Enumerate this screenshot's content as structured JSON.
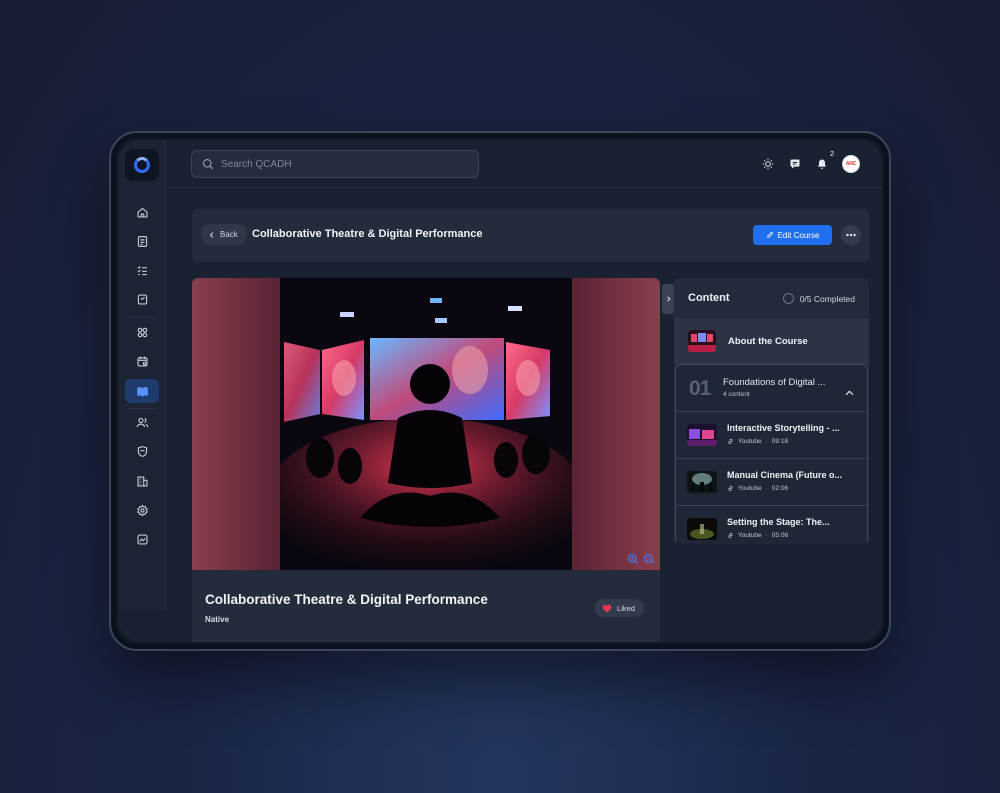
{
  "search": {
    "placeholder": "Search QCADH"
  },
  "topbar": {
    "notification_count": "2",
    "avatar_text": "ANC"
  },
  "header": {
    "back_label": "Back",
    "title": "Collaborative Theatre & Digital Performance",
    "edit_label": "Edit Course"
  },
  "course": {
    "title": "Collaborative Theatre & Digital Performance",
    "subtitle": "Native",
    "liked_label": "Liked"
  },
  "content": {
    "title": "Content",
    "completed": "0/5 Completed",
    "about_label": "About the Course",
    "section": {
      "number": "01",
      "title": "Foundations of Digital ...",
      "count": "4 content"
    },
    "lessons": [
      {
        "title": "Interactive Storytelling - ...",
        "source": "Youtube",
        "duration": "09:18"
      },
      {
        "title": "Manual Cinema (Future o...",
        "source": "Youtube",
        "duration": "02:06"
      },
      {
        "title": "Setting the Stage: The...",
        "source": "Youtube",
        "duration": "05:06"
      }
    ]
  },
  "sidebar": {
    "icons": [
      "home-icon",
      "document-icon",
      "checklist-icon",
      "bookmark-icon",
      "grid-icon",
      "calendar-icon",
      "book-icon",
      "users-icon",
      "shield-icon",
      "building-icon",
      "settings-icon",
      "chart-icon"
    ],
    "active": "book-icon"
  },
  "colors": {
    "accent": "#1f6ff0",
    "background": "#1a2231",
    "panel": "#242c3b",
    "liked": "#e0394d"
  }
}
